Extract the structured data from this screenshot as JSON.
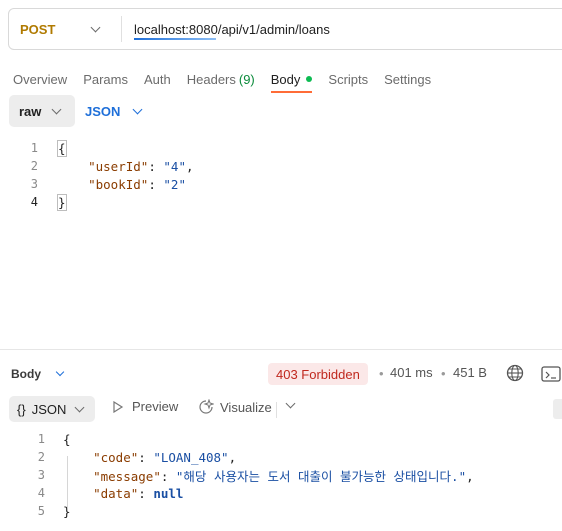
{
  "request": {
    "method": "POST",
    "url": "localhost:8080/api/v1/admin/loans"
  },
  "tabs": [
    {
      "label": "Overview"
    },
    {
      "label": "Params"
    },
    {
      "label": "Auth"
    },
    {
      "label": "Headers",
      "count": "(9)"
    },
    {
      "label": "Body",
      "active": true
    },
    {
      "label": "Scripts"
    },
    {
      "label": "Settings"
    }
  ],
  "body_options": {
    "mode": "raw",
    "language": "JSON"
  },
  "request_body": {
    "line_numbers": [
      "1",
      "2",
      "3",
      "4"
    ],
    "open_brace": "{",
    "close_brace": "}",
    "fields": [
      {
        "key": "\"userId\"",
        "value": "\"4\"",
        "trail": ","
      },
      {
        "key": "\"bookId\"",
        "value": "\"2\"",
        "trail": ""
      }
    ]
  },
  "response": {
    "label": "Body",
    "status": "403 Forbidden",
    "time": "401 ms",
    "size": "451 B",
    "format": "JSON",
    "format_icon": "{}",
    "preview_label": "Preview",
    "visualize_label": "Visualize",
    "line_numbers": [
      "1",
      "2",
      "3",
      "4",
      "5"
    ],
    "open_brace": "{",
    "close_brace": "}",
    "fields": [
      {
        "key": "\"code\"",
        "value": "\"LOAN_408\"",
        "trail": ","
      },
      {
        "key": "\"message\"",
        "value": "\"해당 사용자는 도서 대출이 불가능한 상태입니다.\"",
        "trail": ","
      },
      {
        "key": "\"data\"",
        "value": "null",
        "trail": ""
      }
    ]
  },
  "colors": {
    "method": "#b07a00",
    "accent": "#1e6fd9",
    "active_tab_underline": "#ff6c37",
    "status_bg": "#fbe8e8",
    "status_text": "#c0281e"
  }
}
